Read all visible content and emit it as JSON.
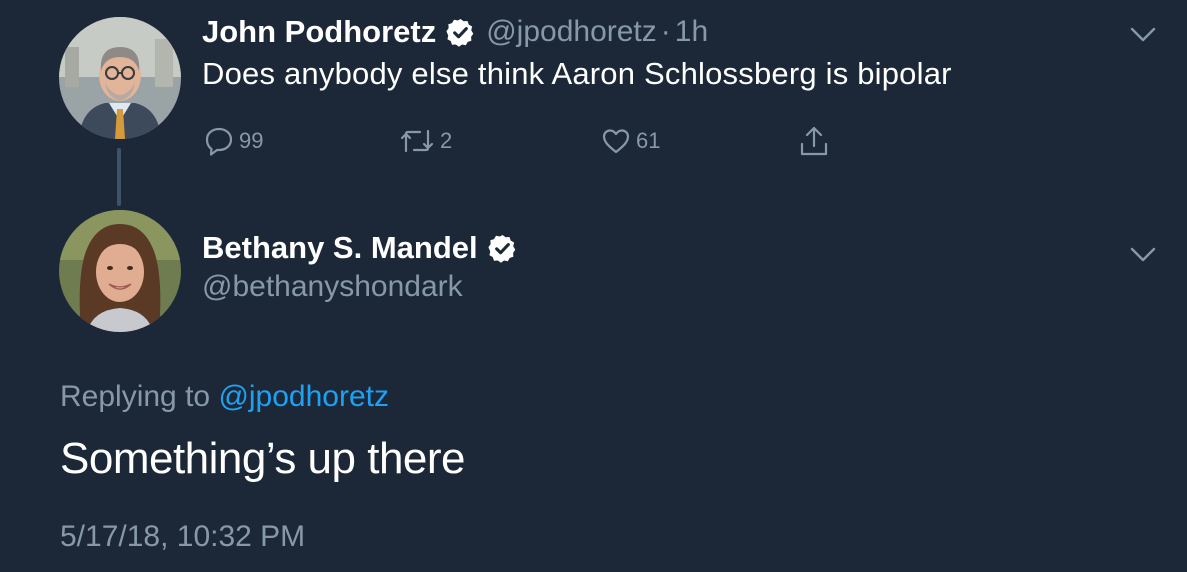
{
  "colors": {
    "background": "#1c2838",
    "primary_text": "#ffffff",
    "secondary_text": "#8899a6",
    "link": "#1da1f2",
    "verified_badge": "#ffffff"
  },
  "tweet1": {
    "display_name": "John Podhoretz",
    "handle": "@jpodhoretz",
    "separator": "·",
    "time_ago": "1h",
    "text": "Does anybody else think Aaron Schlossberg is bipolar",
    "avatar_icon": "profile-photo-man",
    "verified_icon": "verified-badge-icon",
    "actions": {
      "reply_count": "99",
      "retweet_count": "2",
      "like_count": "61"
    }
  },
  "tweet2": {
    "display_name": "Bethany S. Mandel",
    "handle": "@bethanyshondark",
    "avatar_icon": "profile-photo-woman",
    "verified_icon": "verified-badge-icon",
    "replying_prefix": "Replying to ",
    "replying_mention": "@jpodhoretz",
    "text": "Something’s up there",
    "timestamp": "5/17/18, 10:32 PM"
  }
}
